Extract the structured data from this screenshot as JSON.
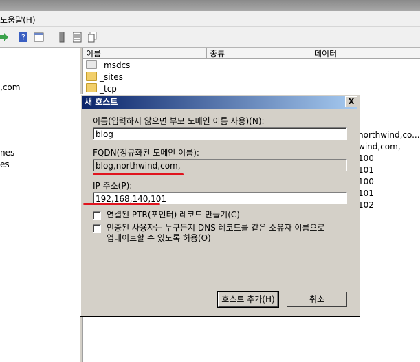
{
  "menu": {
    "help": "도움말(H)"
  },
  "tree": {
    "item1": ",com",
    "item2": "nes",
    "item3": "es"
  },
  "list": {
    "columns": [
      "이름",
      "종류",
      "데이터"
    ],
    "rows": [
      "_msdcs",
      "_sites",
      "_tcp"
    ],
    "right_values": [
      "northwind,co...",
      "wind,com,",
      "100",
      "101",
      "100",
      "101",
      "102"
    ]
  },
  "dialog": {
    "title": "새 호스트",
    "close": "X",
    "name_label": "이름(입력하지 않으면 부모 도메인 이름 사용)(N):",
    "name_value": "blog",
    "fqdn_label": "FQDN(정규화된 도메인 이름):",
    "fqdn_value": "blog,northwind,com,",
    "ip_label": "IP 주소(P):",
    "ip_value": "192,168,140,101",
    "check1": "연결된 PTR(포인터) 레코드 만들기(C)",
    "check2_line1": "인증된 사용자는 누구든지 DNS 레코드를 같은 소유자 이름으로",
    "check2_line2": "업데이트할 수 있도록 허용(O)",
    "add_button": "호스트 추가(H)",
    "cancel_button": "취소"
  },
  "colors": {
    "title_start": "#0a246a",
    "title_end": "#a6caf0",
    "annotation": "#e0141e"
  }
}
